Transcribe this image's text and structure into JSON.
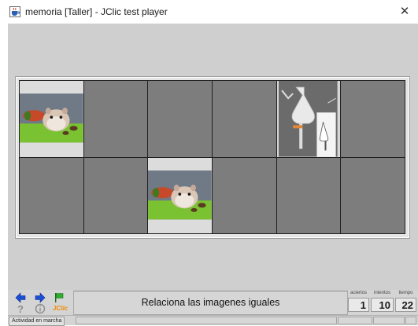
{
  "window": {
    "title": "memoria [Taller] - JClic test player",
    "app_icon": "java-cup-icon",
    "close_icon": "close-icon"
  },
  "board": {
    "rows": 2,
    "cols": 6,
    "cells": [
      {
        "state": "open",
        "image": "hamster-photo"
      },
      {
        "state": "hidden"
      },
      {
        "state": "hidden"
      },
      {
        "state": "hidden"
      },
      {
        "state": "open",
        "image": "separatory-funnel-photo"
      },
      {
        "state": "hidden"
      },
      {
        "state": "hidden"
      },
      {
        "state": "hidden"
      },
      {
        "state": "open",
        "image": "hamster-photo"
      },
      {
        "state": "hidden"
      },
      {
        "state": "hidden"
      },
      {
        "state": "hidden"
      }
    ]
  },
  "controls": {
    "prev_icon": "arrow-left-icon",
    "next_icon": "arrow-right-icon",
    "reset_icon": "flag-icon",
    "help_icon": "question-icon",
    "info_icon": "info-icon",
    "jclic_logo": "JClic"
  },
  "message": "Relaciona las imagenes iguales",
  "counters": {
    "aciertos_label": "aciertos",
    "aciertos_value": "1",
    "intentos_label": "intentos",
    "intentos_value": "10",
    "tiempo_label": "tiempo",
    "tiempo_value": "22"
  },
  "status": {
    "text": "Actividad en marcha"
  },
  "colors": {
    "hidden_cell": "#7d7d7d",
    "board_bg": "#cfcfcf",
    "arrow_blue": "#1b4fd6",
    "flag_green": "#2eae2e"
  }
}
